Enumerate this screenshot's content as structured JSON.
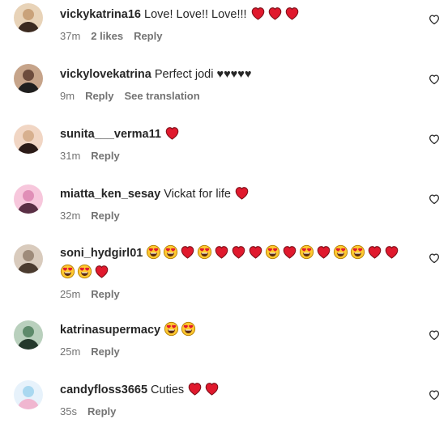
{
  "comments": [
    {
      "username": "vickykatrina16",
      "text": "Love! Love!! Love!!!",
      "emojis": [
        "heart",
        "heart",
        "heart"
      ],
      "time": "37m",
      "likes": "2 likes",
      "reply": "Reply",
      "translate": ""
    },
    {
      "username": "vickylovekatrina",
      "text": "Perfect jodi ♥♥♥♥♥",
      "emojis": [],
      "time": "9m",
      "likes": "",
      "reply": "Reply",
      "translate": "See translation"
    },
    {
      "username": "sunita___verma11",
      "text": "",
      "emojis": [
        "heart"
      ],
      "time": "31m",
      "likes": "",
      "reply": "Reply",
      "translate": ""
    },
    {
      "username": "miatta_ken_sesay",
      "text": "Vickat for life",
      "emojis": [
        "heart"
      ],
      "time": "32m",
      "likes": "",
      "reply": "Reply",
      "translate": ""
    },
    {
      "username": "soni_hydgirl01",
      "text": "",
      "emojis": [
        "heart-eyes",
        "heart-eyes",
        "heart",
        "heart-eyes",
        "heart",
        "heart",
        "heart",
        "heart-eyes",
        "heart",
        "heart-eyes",
        "heart",
        "heart-eyes",
        "heart-eyes",
        "heart",
        "heart",
        "heart-eyes",
        "heart-eyes",
        "heart"
      ],
      "time": "25m",
      "likes": "",
      "reply": "Reply",
      "translate": ""
    },
    {
      "username": "katrinasupermacy",
      "text": "",
      "emojis": [
        "heart-eyes",
        "heart-eyes"
      ],
      "time": "25m",
      "likes": "",
      "reply": "Reply",
      "translate": ""
    },
    {
      "username": "candyfloss3665",
      "text": "Cuties",
      "emojis": [
        "heart",
        "heart"
      ],
      "time": "35s",
      "likes": "",
      "reply": "Reply",
      "translate": ""
    }
  ],
  "icons": {
    "like": "heart-outline-icon",
    "heart_emoji": "red-heart-emoji",
    "heart_eyes_emoji": "heart-eyes-emoji"
  },
  "colors": {
    "text": "#262626",
    "secondary": "#737373",
    "heart": "#e0192d"
  }
}
